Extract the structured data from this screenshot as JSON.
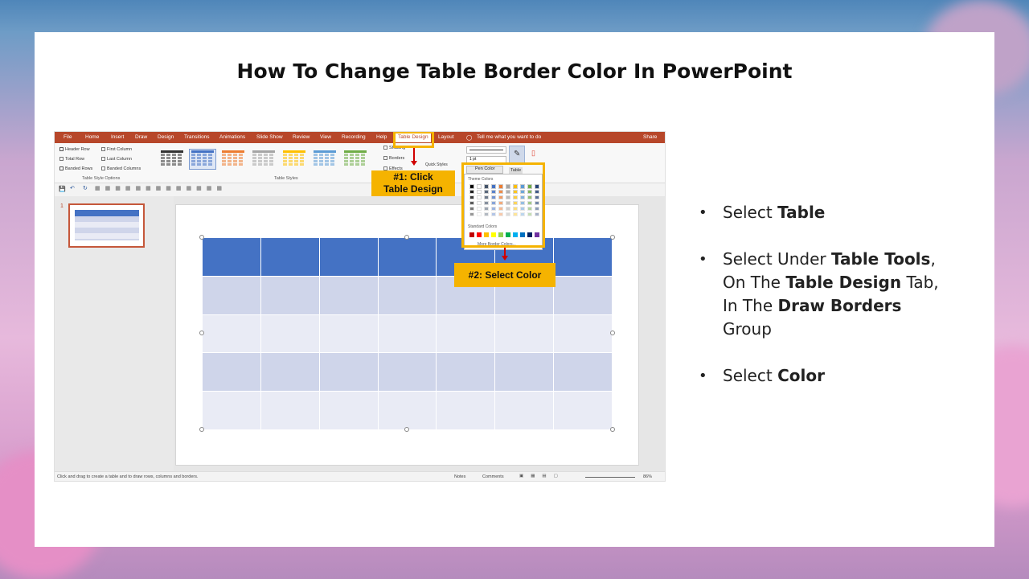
{
  "slide": {
    "title": "How To Change Table Border Color In PowerPoint"
  },
  "powerpoint": {
    "tabs": [
      "File",
      "Home",
      "Insert",
      "Draw",
      "Design",
      "Transitions",
      "Animations",
      "Slide Show",
      "Review",
      "View",
      "Recording",
      "Help",
      "Table Design",
      "Layout"
    ],
    "active_tab": "Table Design",
    "tell_me": "Tell me what you want to do",
    "share": "Share",
    "style_options": [
      "Header Row",
      "First Column",
      "Total Row",
      "Last Column",
      "Banded Rows",
      "Banded Columns"
    ],
    "checked_options": [
      "Header Row",
      "Banded Rows"
    ],
    "group_style_options": "Table Style Options",
    "group_table_styles": "Table Styles",
    "shading_label": "Shading",
    "borders_label": "Borders",
    "effects_label": "Effects",
    "quick_styles_label": "Quick Styles",
    "pen_weight": "1 pt",
    "pen_color_label": "Pen Color",
    "table_label": "Table",
    "theme_colors_label": "Theme Colors",
    "standard_colors_label": "Standard Colors",
    "more_colors_label": "More Border Colors...",
    "theme_colors": [
      "#000000",
      "#ffffff",
      "#44546a",
      "#4472c4",
      "#ed7d31",
      "#a5a5a5",
      "#ffc000",
      "#5b9bd5",
      "#70ad47",
      "#264478"
    ],
    "standard_colors": [
      "#c00000",
      "#ff0000",
      "#ffc000",
      "#ffff00",
      "#92d050",
      "#00b050",
      "#00b0f0",
      "#0070c0",
      "#002060",
      "#7030a0"
    ],
    "slide_number": "1",
    "status_text": "Click and drag to create a table and to draw rows, columns and borders.",
    "notes_label": "Notes",
    "comments_label": "Comments",
    "zoom": "86%"
  },
  "callouts": {
    "step1_line1": "#1: Click",
    "step1_line2": "Table Design",
    "step2": "#2: Select Color"
  },
  "instructions": {
    "b1_pre": "Select ",
    "b1_bold": "Table",
    "b2_pre": "Select Under ",
    "b2_bold1": "Table Tools",
    "b2_mid1": ", On The ",
    "b2_bold2": "Table Design",
    "b2_mid2": " Tab, In The ",
    "b2_bold3": "Draw Borders",
    "b2_end": " Group",
    "b3_pre": "Select ",
    "b3_bold": "Color"
  },
  "colors": {
    "ribbon_red": "#b7472a",
    "header_blue": "#4472c4",
    "band_dark": "#cfd5ea",
    "band_light": "#e9ebf5",
    "callout_yellow": "#f5b300"
  }
}
